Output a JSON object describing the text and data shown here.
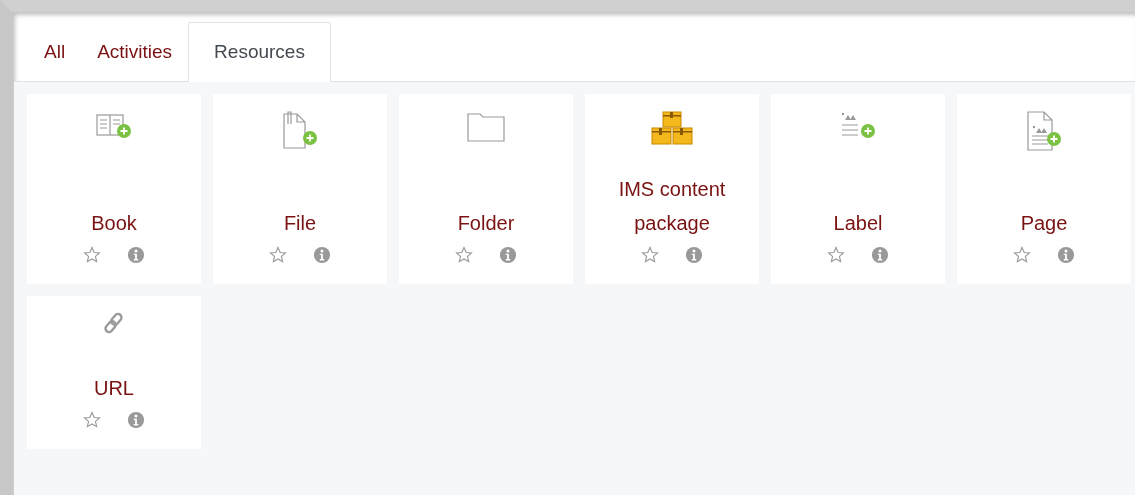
{
  "tabs": [
    {
      "label": "All",
      "selected": false
    },
    {
      "label": "Activities",
      "selected": false
    },
    {
      "label": "Resources",
      "selected": true
    }
  ],
  "modules": [
    {
      "kind": "book",
      "name": "Book",
      "starred": false
    },
    {
      "kind": "file",
      "name": "File",
      "starred": false
    },
    {
      "kind": "folder",
      "name": "Folder",
      "starred": false
    },
    {
      "kind": "package",
      "name": "IMS content package",
      "starred": false
    },
    {
      "kind": "label",
      "name": "Label",
      "starred": false
    },
    {
      "kind": "page",
      "name": "Page",
      "starred": false
    },
    {
      "kind": "url",
      "name": "URL",
      "starred": false
    }
  ]
}
